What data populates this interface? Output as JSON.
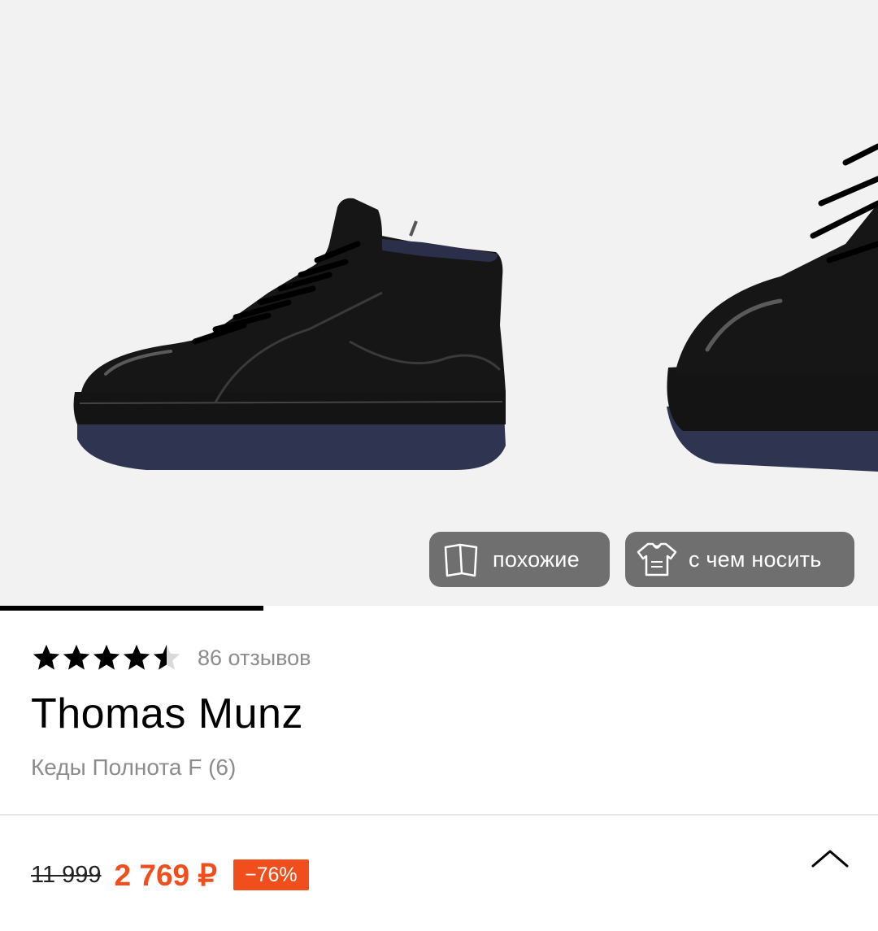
{
  "gallery": {
    "buttons": {
      "similar_label": "похожие",
      "outfit_label": "с чем носить"
    },
    "progress_fraction": 0.3
  },
  "product": {
    "rating_value": 4.5,
    "reviews_label": "86 отзывов",
    "brand": "Thomas Munz",
    "subtitle": "Кеды Полнота F (6)"
  },
  "price": {
    "old": "11 999",
    "current": "2 769 ₽",
    "discount": "−76%"
  },
  "colors": {
    "accent": "#f04e1c",
    "pill_bg": "#6f6f6f",
    "muted_text": "#8c8c8c"
  },
  "icons": {
    "similar": "pages-icon",
    "outfit": "tshirt-icon",
    "collapse": "chevron-up-icon",
    "star": "star-icon"
  }
}
